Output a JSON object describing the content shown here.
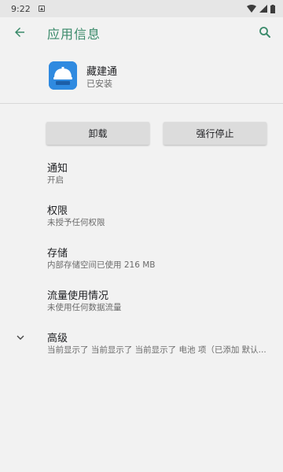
{
  "status_bar": {
    "time": "9:22"
  },
  "app_bar": {
    "title": "应用信息",
    "back_icon": "arrow-back-icon",
    "search_icon": "search-icon"
  },
  "app_header": {
    "name": "藏建通",
    "install_status": "已安装",
    "icon_color": "#2f8ae0"
  },
  "actions": {
    "uninstall_label": "卸载",
    "force_stop_label": "强行停止"
  },
  "settings": [
    {
      "title": "通知",
      "subtitle": "开启"
    },
    {
      "title": "权限",
      "subtitle": "未授予任何权限"
    },
    {
      "title": "存储",
      "subtitle": "内部存储空间已使用 216 MB"
    },
    {
      "title": "流量使用情况",
      "subtitle": "未使用任何数据流量"
    }
  ],
  "advanced": {
    "title": "高级",
    "subtitle": "当前显示了 当前显示了 当前显示了 电池 项（已添加 默认..."
  },
  "colors": {
    "accent": "#3a8a6a",
    "background": "#f2f2f2",
    "button_bg": "#dcdcdc"
  }
}
